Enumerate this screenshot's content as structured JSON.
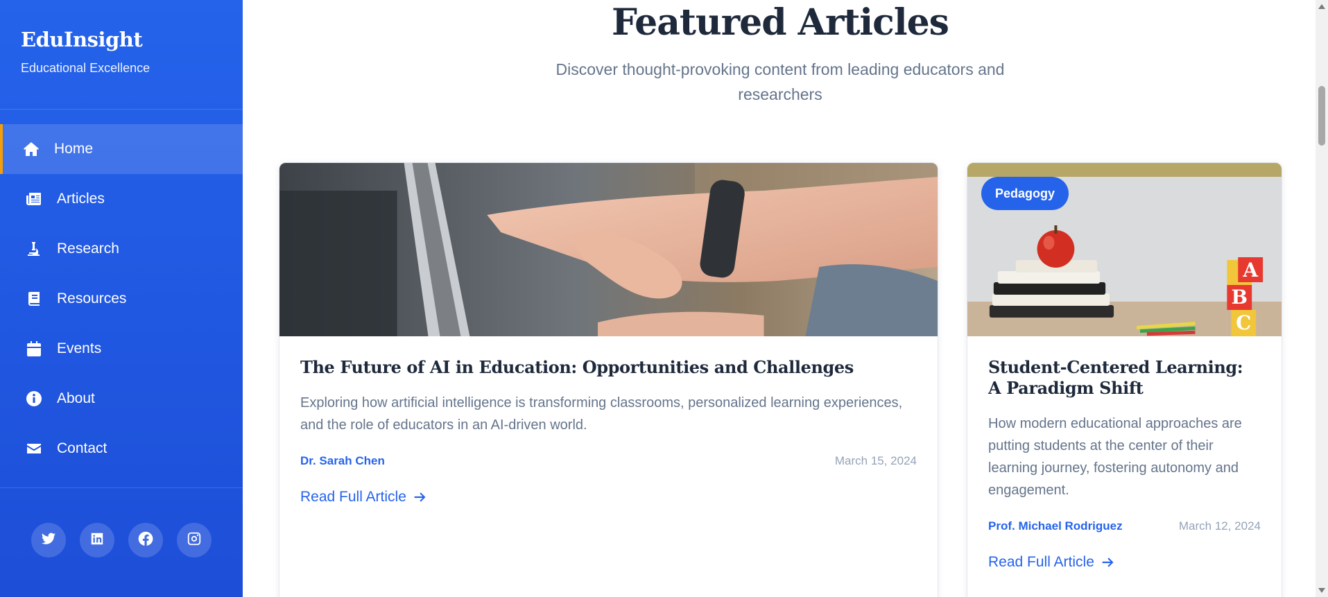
{
  "brand": {
    "name": "EduInsight",
    "tagline": "Educational Excellence"
  },
  "nav": {
    "items": [
      {
        "label": "Home",
        "icon": "home-icon",
        "active": true
      },
      {
        "label": "Articles",
        "icon": "newspaper-icon",
        "active": false
      },
      {
        "label": "Research",
        "icon": "microscope-icon",
        "active": false
      },
      {
        "label": "Resources",
        "icon": "book-icon",
        "active": false
      },
      {
        "label": "Events",
        "icon": "calendar-icon",
        "active": false
      },
      {
        "label": "About",
        "icon": "info-icon",
        "active": false
      },
      {
        "label": "Contact",
        "icon": "envelope-icon",
        "active": false
      }
    ],
    "accent_color": "#f59e0b"
  },
  "socials": [
    "twitter-icon",
    "linkedin-icon",
    "facebook-icon",
    "instagram-icon"
  ],
  "section": {
    "title": "Featured Articles",
    "subtitle_line1": "Discover thought-provoking content from leading educators and",
    "subtitle_line2": "researchers"
  },
  "articles": [
    {
      "title": "The Future of AI in Education: Opportunities and Challenges",
      "excerpt": "Exploring how artificial intelligence is transforming classrooms, personalized learning experiences, and the role of educators in an AI-driven world.",
      "author": "Dr. Sarah Chen",
      "date": "March 15, 2024",
      "cta": "Read Full Article"
    },
    {
      "category": "Pedagogy",
      "title": "Student-Centered Learning: A Paradigm Shift",
      "excerpt": "How modern educational approaches are putting students at the center of their learning journey, fostering autonomy and engagement.",
      "author": "Prof. Michael Rodriguez",
      "date": "March 12, 2024",
      "cta": "Read Full Article"
    }
  ],
  "colors": {
    "primary": "#2563eb",
    "heading": "#1e293b",
    "muted": "#64748b"
  }
}
